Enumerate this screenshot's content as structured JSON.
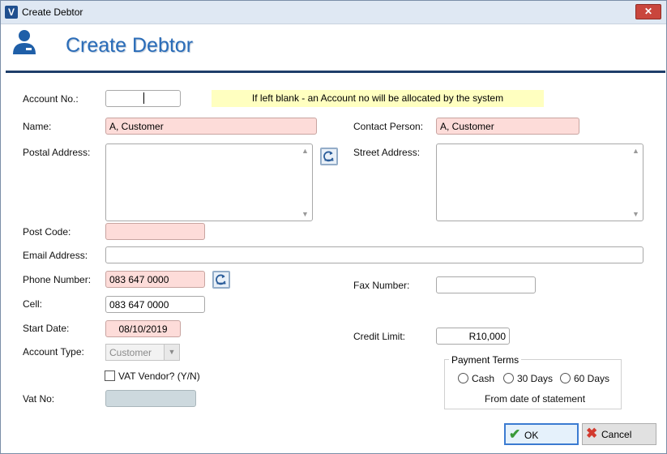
{
  "window": {
    "title": "Create Debtor",
    "app_icon_letter": "V",
    "close_glyph": "✕"
  },
  "header": {
    "title": "Create Debtor",
    "icon": "user-icon"
  },
  "form": {
    "account_no": {
      "label": "Account No.:",
      "value": "",
      "hint": "If left blank - an Account no will be allocated by the system"
    },
    "name": {
      "label": "Name:",
      "value": "A, Customer"
    },
    "contact_person": {
      "label": "Contact Person:",
      "value": "A, Customer"
    },
    "postal_address": {
      "label": "Postal Address:",
      "value": ""
    },
    "street_address": {
      "label": "Street Address:",
      "value": ""
    },
    "post_code": {
      "label": "Post Code:",
      "value": ""
    },
    "email_address": {
      "label": "Email Address:",
      "value": ""
    },
    "phone_number": {
      "label": "Phone Number:",
      "value": "083 647 0000"
    },
    "fax_number": {
      "label": "Fax Number:",
      "value": ""
    },
    "cell": {
      "label": "Cell:",
      "value": "083 647 0000"
    },
    "start_date": {
      "label": "Start Date:",
      "value": "08/10/2019"
    },
    "credit_limit": {
      "label": "Credit Limit:",
      "value": "R10,000"
    },
    "account_type": {
      "label": "Account Type:",
      "value": "Customer"
    },
    "vat_vendor": {
      "label": "VAT Vendor? (Y/N)",
      "checked": false
    },
    "vat_no": {
      "label": "Vat No:",
      "value": ""
    },
    "payment_terms": {
      "title": "Payment Terms",
      "options": [
        "Cash",
        "30 Days",
        "60 Days"
      ],
      "selected": null,
      "note": "From date of statement"
    }
  },
  "buttons": {
    "ok": "OK",
    "cancel": "Cancel"
  },
  "colors": {
    "required_field": "#fddcd9",
    "header_accent": "#2a6cb8",
    "hint_background": "#ffffc0",
    "rule": "#1f3e6a"
  }
}
